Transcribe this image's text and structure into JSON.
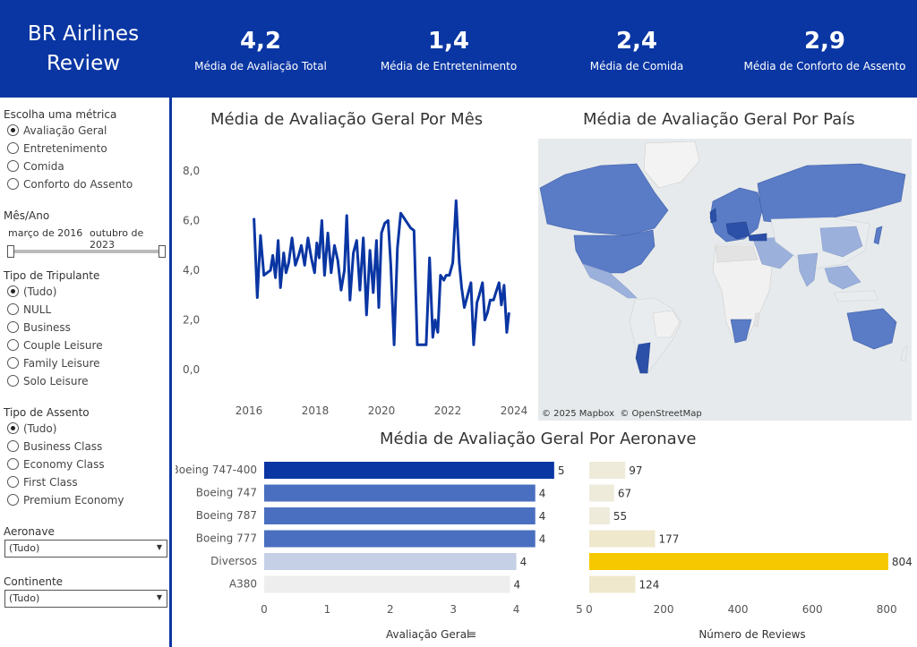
{
  "header": {
    "brand_line1": "BR Airlines",
    "brand_line2": "Review",
    "kpis": [
      {
        "value": "4,2",
        "label": "Média de Avaliação Total"
      },
      {
        "value": "1,4",
        "label": "Média de Entretenimento"
      },
      {
        "value": "2,4",
        "label": "Média de Comida"
      },
      {
        "value": "2,9",
        "label": "Média de Conforto de Assento"
      }
    ]
  },
  "filters": {
    "metric": {
      "title": "Escolha uma métrica",
      "options": [
        "Avaliação Geral",
        "Entretenimento",
        "Comida",
        "Conforto do Assento"
      ],
      "selected": 0
    },
    "date": {
      "title": "Mês/Ano",
      "start": "março de 2016",
      "end": "outubro de 2023"
    },
    "crew": {
      "title": "Tipo de Tripulante",
      "options": [
        "(Tudo)",
        "NULL",
        "Business",
        "Couple Leisure",
        "Family Leisure",
        "Solo Leisure"
      ],
      "selected": 0
    },
    "seat": {
      "title": "Tipo de Assento",
      "options": [
        "(Tudo)",
        "Business Class",
        "Economy Class",
        "First Class",
        "Premium Economy"
      ],
      "selected": 0
    },
    "aircraft": {
      "title": "Aeronave",
      "value": "(Tudo)"
    },
    "continent": {
      "title": "Continente",
      "value": "(Tudo)"
    }
  },
  "colors": {
    "brand": "#0a36a3",
    "line": "#0a36a3",
    "bar_top": "#0a36a3",
    "bar_mid": "#4a6fc0",
    "bar_light": "#c5d0e6",
    "bar_lightest": "#eeeeee",
    "reviews_high": "#f5c800",
    "reviews_low": "#eeebdb"
  },
  "map": {
    "attribution": "© 2025 Mapbox  © OpenStreetMap",
    "highlighted_regions": [
      "North America",
      "South America",
      "Europe",
      "Russia",
      "Australia",
      "Southern Africa",
      "Southeast Asia"
    ]
  },
  "chart_data": [
    {
      "type": "line",
      "title": "Média de Avaliação Geral Por Mês",
      "xlim": [
        2016,
        2024
      ],
      "ylim": [
        0,
        8
      ],
      "x_ticks": [
        "2016",
        "2018",
        "2020",
        "2022",
        "2024"
      ],
      "y_ticks": [
        "0,0",
        "2,0",
        "4,0",
        "6,0",
        "8,0"
      ],
      "series": [
        {
          "x": [
            2016.15,
            2016.25,
            2016.35,
            2016.45,
            2016.55,
            2016.65,
            2016.72,
            2016.8,
            2016.88,
            2016.95,
            2017.05,
            2017.12,
            2017.2,
            2017.3,
            2017.4,
            2017.5,
            2017.58,
            2017.68,
            2017.78,
            2017.88,
            2017.98,
            2018.05,
            2018.12,
            2018.2,
            2018.28,
            2018.38,
            2018.48,
            2018.58,
            2018.68,
            2018.78,
            2018.88,
            2018.95,
            2019.05,
            2019.15,
            2019.25,
            2019.35,
            2019.45,
            2019.55,
            2019.65,
            2019.75,
            2019.85,
            2019.92,
            2020.0,
            2020.1,
            2020.2,
            2020.28,
            2020.38,
            2020.48,
            2020.58,
            2020.68,
            2020.78,
            2020.88,
            2020.98,
            2021.08,
            2021.15,
            2021.22,
            2021.28,
            2021.35,
            2021.45,
            2021.55,
            2021.62,
            2021.7,
            2021.78,
            2021.88,
            2021.95,
            2022.05,
            2022.15,
            2022.25,
            2022.35,
            2022.42,
            2022.5,
            2022.6,
            2022.7,
            2022.78,
            2022.88,
            2022.95,
            2023.05,
            2023.12,
            2023.2,
            2023.28,
            2023.38,
            2023.45,
            2023.55,
            2023.62,
            2023.7,
            2023.78,
            2023.85
          ],
          "y": [
            6.1,
            2.9,
            5.4,
            3.8,
            3.9,
            4.0,
            4.6,
            3.7,
            5.2,
            3.3,
            4.7,
            3.9,
            4.3,
            5.3,
            4.2,
            4.6,
            5.0,
            4.2,
            5.3,
            4.5,
            3.9,
            5.1,
            4.5,
            6.0,
            3.8,
            5.5,
            3.9,
            5.0,
            4.4,
            3.2,
            4.0,
            6.2,
            2.8,
            4.7,
            5.2,
            3.2,
            5.3,
            2.2,
            4.8,
            3.1,
            5.2,
            2.5,
            5.5,
            5.9,
            6.0,
            4.2,
            1.0,
            4.9,
            6.3,
            6.1,
            5.9,
            5.7,
            5.6,
            1.0,
            1.0,
            1.0,
            1.0,
            1.0,
            4.5,
            1.3,
            2.0,
            1.5,
            3.8,
            3.6,
            3.8,
            3.8,
            4.3,
            6.8,
            4.3,
            3.3,
            2.5,
            3.0,
            3.5,
            1.0,
            2.7,
            3.0,
            3.5,
            2.0,
            2.3,
            2.8,
            2.8,
            3.1,
            3.5,
            2.6,
            3.4,
            1.5,
            2.3
          ]
        }
      ]
    },
    {
      "type": "bar",
      "title": "Média de Avaliação Geral Por Aeronave",
      "orientation": "horizontal",
      "categories": [
        "Boeing 747-400",
        "Boeing 747",
        "Boeing 787",
        "Boeing 777",
        "Diversos",
        "A380"
      ],
      "values": [
        5,
        4,
        4,
        4,
        4,
        4
      ],
      "exact_values": [
        4.6,
        4.3,
        4.3,
        4.3,
        4.0,
        3.9
      ],
      "xlabel": "Avaliação Geral",
      "xlim": [
        0,
        5
      ],
      "x_ticks": [
        "0",
        "1",
        "2",
        "3",
        "4",
        "5"
      ]
    },
    {
      "type": "bar",
      "orientation": "horizontal",
      "categories": [
        "Boeing 747-400",
        "Boeing 747",
        "Boeing 787",
        "Boeing 777",
        "Diversos",
        "A380"
      ],
      "values": [
        97,
        67,
        55,
        177,
        804,
        124
      ],
      "xlabel": "Número de Reviews",
      "xlim": [
        0,
        850
      ],
      "x_ticks": [
        "0",
        "200",
        "400",
        "600",
        "800"
      ]
    }
  ],
  "titles": {
    "line": "Média de Avaliação Geral Por Mês",
    "map": "Média de Avaliação Geral Por País",
    "bars": "Média de Avaliação Geral Por Aeronave"
  }
}
